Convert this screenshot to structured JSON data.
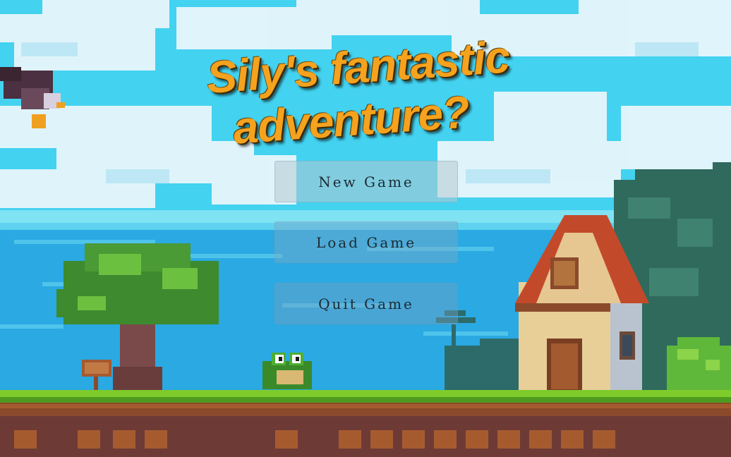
{
  "game": {
    "title_line1": "Sily's fantastic",
    "title_line2": "adventure?"
  },
  "menu": {
    "new_game": "New Game",
    "load_game": "Load Game",
    "quit_game": "Quit Game"
  },
  "colors": {
    "sky": "#3fd0f0",
    "sea": "#2aa8e0",
    "title": "#f5a21e",
    "grass": "#7ecb2b",
    "dirt": "#8b4a2b"
  }
}
